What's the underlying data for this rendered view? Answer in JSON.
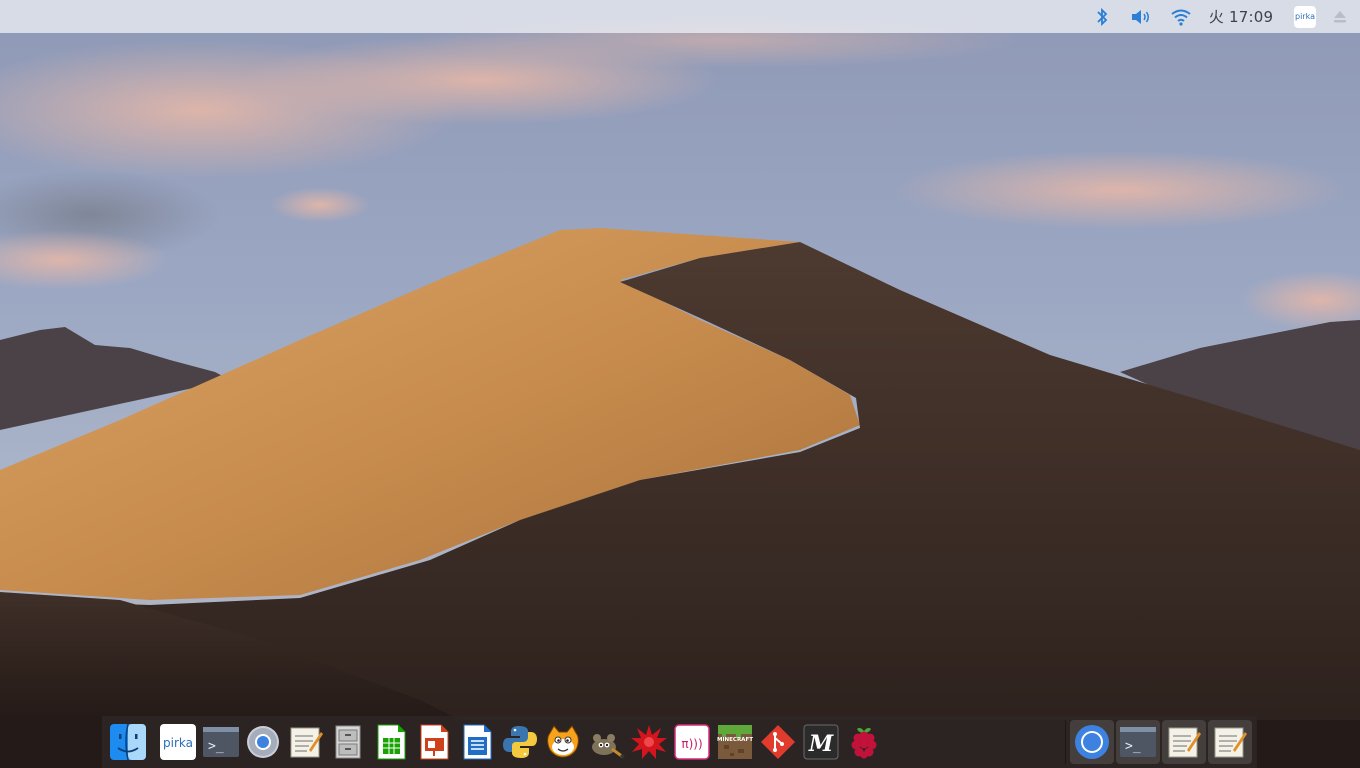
{
  "menubar": {
    "clock": "火 17:09",
    "pirka_badge": "pirka"
  },
  "dock": {
    "pinned_apps": [
      {
        "name": "Finder",
        "icon": "finder-icon"
      },
      {
        "name": "pirka",
        "icon": "pirka-icon",
        "label": "pirka"
      },
      {
        "name": "Terminal",
        "icon": "terminal-icon",
        "label": ">_"
      },
      {
        "name": "Chromium",
        "icon": "chromium-icon"
      },
      {
        "name": "Text Editor",
        "icon": "text-editor-icon"
      },
      {
        "name": "File Manager",
        "icon": "file-manager-icon"
      },
      {
        "name": "LibreOffice Calc",
        "icon": "libreoffice-calc-icon"
      },
      {
        "name": "LibreOffice Impress",
        "icon": "libreoffice-impress-icon"
      },
      {
        "name": "LibreOffice Writer",
        "icon": "libreoffice-writer-icon"
      },
      {
        "name": "Python",
        "icon": "python-icon"
      },
      {
        "name": "Scratch",
        "icon": "scratch-icon"
      },
      {
        "name": "GIMP",
        "icon": "gimp-icon"
      },
      {
        "name": "Red burst app",
        "icon": "burst-icon"
      },
      {
        "name": "Pi radio",
        "icon": "pi-radio-icon",
        "label": "π)))"
      },
      {
        "name": "Minecraft Pi",
        "icon": "minecraft-icon",
        "label": "MINECRAFT"
      },
      {
        "name": "Git",
        "icon": "git-icon"
      },
      {
        "name": "Mathematica",
        "icon": "mathematica-icon",
        "label": "M"
      },
      {
        "name": "Raspberry Pi menu",
        "icon": "raspberry-icon"
      }
    ],
    "running_apps": [
      {
        "name": "Chromium",
        "icon": "chromium-icon"
      },
      {
        "name": "Terminal",
        "icon": "terminal-icon",
        "label": ">_"
      },
      {
        "name": "Text Editor",
        "icon": "text-editor-icon"
      },
      {
        "name": "Text Editor",
        "icon": "text-editor-icon"
      }
    ]
  },
  "colors": {
    "accent_blue": "#2a7fd6",
    "menubar_bg": "#e8eaf0",
    "dock_bg": "#2e2828"
  }
}
